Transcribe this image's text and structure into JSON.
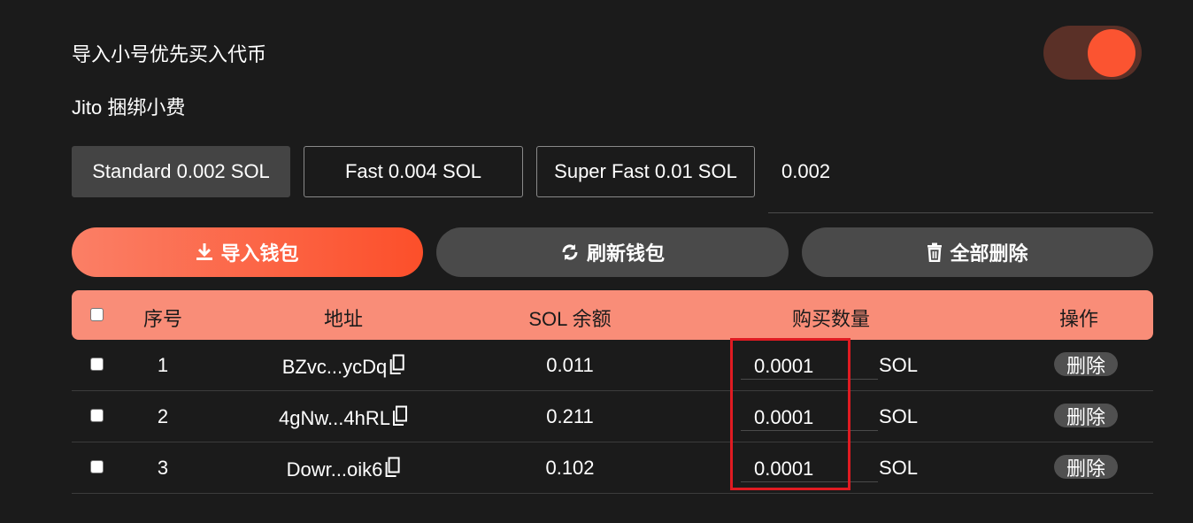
{
  "settings": {
    "priority_buy_label": "导入小号优先买入代币",
    "priority_buy_enabled": true,
    "jito_tip_label": "Jito 捆绑小费",
    "fee_options": [
      {
        "label": "Standard 0.002 SOL",
        "active": true
      },
      {
        "label": "Fast 0.004 SOL",
        "active": false
      },
      {
        "label": "Super Fast 0.01 SOL",
        "active": false
      }
    ],
    "fee_value": "0.002"
  },
  "actions": {
    "import_label": "导入钱包",
    "refresh_label": "刷新钱包",
    "delete_all_label": "全部删除"
  },
  "table": {
    "headers": {
      "index": "序号",
      "address": "地址",
      "balance": "SOL 余额",
      "amount": "购买数量",
      "actions": "操作"
    },
    "rows": [
      {
        "index": "1",
        "address": "BZvc...ycDq",
        "balance": "0.011",
        "amount": "0.0001",
        "unit": "SOL",
        "delete": "删除"
      },
      {
        "index": "2",
        "address": "4gNw...4hRL",
        "balance": "0.211",
        "amount": "0.0001",
        "unit": "SOL",
        "delete": "删除"
      },
      {
        "index": "3",
        "address": "Dowr...oik6",
        "balance": "0.102",
        "amount": "0.0001",
        "unit": "SOL",
        "delete": "删除"
      }
    ]
  },
  "colors": {
    "background": "#1b1b1b",
    "accent": "#fc4f2a",
    "table_header": "#f98d78",
    "highlight": "#e01b22"
  },
  "icons": {
    "import": "download-icon",
    "refresh": "refresh-icon",
    "delete_all": "trash-icon",
    "copy": "copy-icon"
  }
}
